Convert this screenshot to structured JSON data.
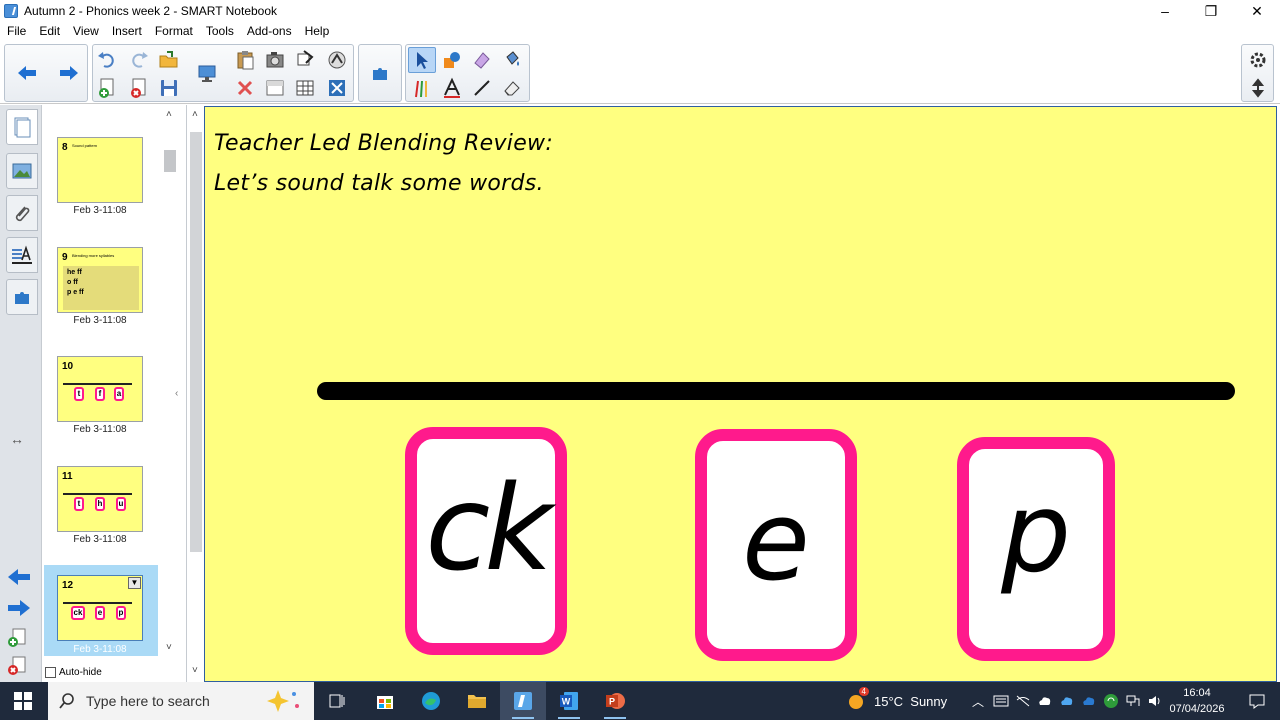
{
  "window": {
    "title": "Autumn 2 - Phonics week 2 - SMART Notebook",
    "minimize": "–",
    "restore": "❐",
    "close": "✕"
  },
  "menu": [
    "File",
    "Edit",
    "View",
    "Insert",
    "Format",
    "Tools",
    "Add-ons",
    "Help"
  ],
  "toolbar": {
    "icons": [
      "back-arrow-icon",
      "forward-arrow-icon",
      "undo-icon",
      "redo-icon",
      "open-file-icon",
      "new-page-icon",
      "delete-page-icon",
      "save-icon",
      "screen-share-icon",
      "paste-icon",
      "screen-capture-icon",
      "fill-icon",
      "delete-icon",
      "screen-shade-icon",
      "table-icon",
      "document-camera-icon",
      "full-screen-icon",
      "add-ons-icon",
      "select-icon",
      "shapes-icon",
      "magic-pen-icon",
      "fill-bucket-icon",
      "pens-icon",
      "text-icon",
      "lines-icon",
      "eraser-icon",
      "settings-icon",
      "move-toolbar-icon"
    ]
  },
  "sorter": {
    "thumbnails": [
      {
        "number": "8",
        "header": "Sound pattern",
        "date": "Feb 3-11:08"
      },
      {
        "number": "9",
        "header": "Blending more syllables",
        "words": [
          "he ff",
          "o ff",
          "p e ff"
        ],
        "date": "Feb 3-11:08"
      },
      {
        "number": "10",
        "letters": [
          "t",
          "f",
          "a"
        ],
        "date": "Feb 3-11:08"
      },
      {
        "number": "11",
        "letters": [
          "t",
          "h",
          "u"
        ],
        "date": "Feb 3-11:08"
      },
      {
        "number": "12",
        "letters": [
          "ck",
          "e",
          "p"
        ],
        "date": "Feb 3-11:08"
      }
    ],
    "autohide_label": "Auto-hide",
    "selected_index": 4
  },
  "canvas": {
    "heading_line1": "Teacher Led Blending Review:",
    "heading_line2": "Let’s sound talk some words.",
    "grapheme_cards": [
      "ck",
      "e",
      "p"
    ],
    "background_color": "#ffff80",
    "card_border_color": "#ff1a8c"
  },
  "taskbar": {
    "search_placeholder": "Type here to search",
    "weather_badge": "4",
    "weather_text": "15°C  Sunny",
    "time": "16:04",
    "date": "07/04/2026"
  }
}
